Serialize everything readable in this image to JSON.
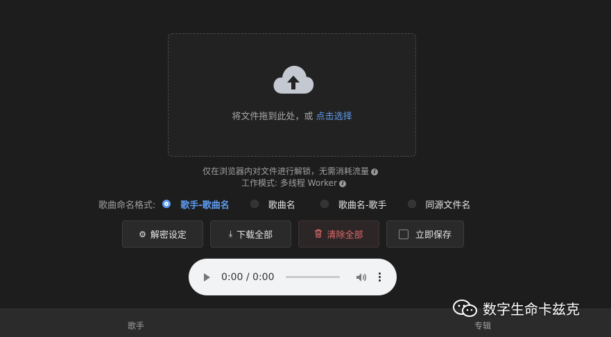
{
  "upload": {
    "hint": "将文件拖到此处，或",
    "link": "点击选择",
    "icon": "cloud-upload-icon"
  },
  "notes": {
    "line1": "仅在浏览器内对文件进行解锁，无需消耗流量",
    "line2": "工作模式: 多线程 Worker"
  },
  "naming": {
    "label": "歌曲命名格式:",
    "options": [
      {
        "label": "歌手-歌曲名",
        "selected": true
      },
      {
        "label": "歌曲名",
        "selected": false
      },
      {
        "label": "歌曲名-歌手",
        "selected": false
      },
      {
        "label": "同源文件名",
        "selected": false
      }
    ]
  },
  "toolbar": {
    "settings_label": "解密设定",
    "download_label": "下载全部",
    "clear_label": "清除全部",
    "save_label": "立即保存"
  },
  "player": {
    "time": "0:00 / 0:00"
  },
  "table": {
    "columns": [
      "歌手",
      "专辑"
    ]
  },
  "watermark": {
    "text": "数字生命卡兹克"
  },
  "colors": {
    "accent": "#5e9cf0",
    "danger": "#e06b6b",
    "background": "#1d1d1d"
  }
}
